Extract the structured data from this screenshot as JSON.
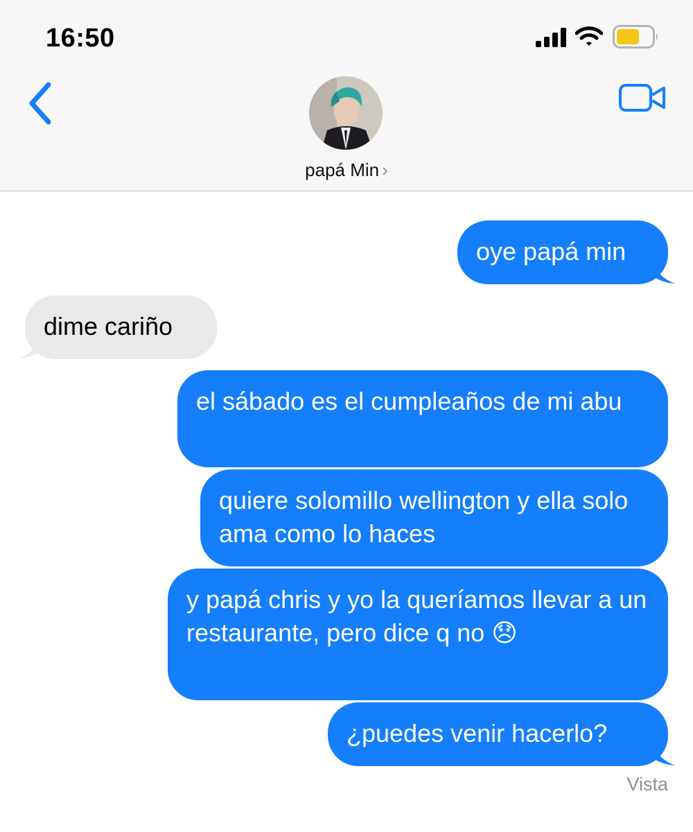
{
  "status_bar": {
    "time": "16:50",
    "icons": [
      "signal-icon",
      "wifi-icon",
      "battery-icon"
    ],
    "battery_color": "#f5c518"
  },
  "header": {
    "back_icon": "chevron-left-icon",
    "video_icon": "video-camera-icon",
    "contact_name": "papá Min",
    "name_chevron": "›",
    "accent_color": "#157efb"
  },
  "messages": [
    {
      "direction": "sent",
      "text": "oye papá min"
    },
    {
      "direction": "received",
      "text": "dime cariño"
    },
    {
      "direction": "sent",
      "text": "el sábado es el cumpleaños de mi abu"
    },
    {
      "direction": "sent",
      "text": "quiere solomillo wellington y ella solo ama como lo haces"
    },
    {
      "direction": "sent",
      "text": "y papá chris y yo la queríamos llevar a un restaurante, pero dice q no 😞"
    },
    {
      "direction": "sent",
      "text": "¿puedes venir hacerlo?"
    }
  ],
  "read_receipt": "Vista",
  "colors": {
    "sent_bubble": "#157efb",
    "received_bubble": "#e9e9eb"
  }
}
